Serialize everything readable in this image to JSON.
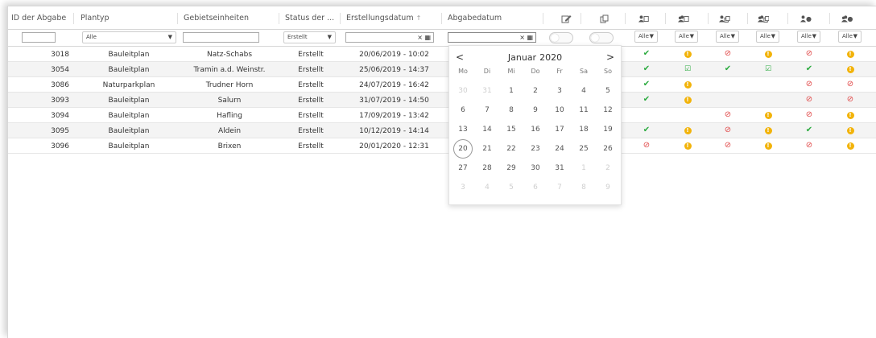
{
  "columns": [
    "ID der Abgabe",
    "Plantyp",
    "Gebietseinheiten",
    "Status der ...",
    "Erstellungsdatum",
    "Abgabedatum"
  ],
  "sort_indicator": "↑",
  "filters": {
    "plantyp": "Alle",
    "status": "Erstellt",
    "date_clear": "×",
    "date_cal": "▦",
    "alle": "Alle"
  },
  "status_icons": [
    "edit-icon",
    "copy-icon",
    "user-edit-icon",
    "group-edit-icon",
    "user-copy-icon",
    "group-copy-icon",
    "user-dot-icon",
    "group-dot-icon"
  ],
  "rows": [
    {
      "id": "3018",
      "plantyp": "Bauleitplan",
      "gebiet": "Natz-Schabs",
      "status": "Erstellt",
      "datum": "20/06/2019 - 10:02",
      "marks": [
        "ok",
        "warn",
        "no",
        "warn",
        "no",
        "warn"
      ]
    },
    {
      "id": "3054",
      "plantyp": "Bauleitplan",
      "gebiet": "Tramin a.d. Weinstr.",
      "status": "Erstellt",
      "datum": "25/06/2019 - 14:37",
      "marks": [
        "ok",
        "edit",
        "ok",
        "edit",
        "ok",
        "warn"
      ]
    },
    {
      "id": "3086",
      "plantyp": "Naturparkplan",
      "gebiet": "Trudner Horn",
      "status": "Erstellt",
      "datum": "24/07/2019 - 16:42",
      "marks": [
        "ok",
        "warn",
        "",
        "",
        "no",
        "no"
      ]
    },
    {
      "id": "3093",
      "plantyp": "Bauleitplan",
      "gebiet": "Salurn",
      "status": "Erstellt",
      "datum": "31/07/2019 - 14:50",
      "marks": [
        "ok",
        "warn",
        "",
        "",
        "no",
        "no"
      ]
    },
    {
      "id": "3094",
      "plantyp": "Bauleitplan",
      "gebiet": "Hafling",
      "status": "Erstellt",
      "datum": "17/09/2019 - 13:42",
      "marks": [
        "",
        "",
        "no",
        "warn",
        "no",
        "warn"
      ]
    },
    {
      "id": "3095",
      "plantyp": "Bauleitplan",
      "gebiet": "Aldein",
      "status": "Erstellt",
      "datum": "10/12/2019 - 14:14",
      "marks": [
        "ok",
        "warn",
        "no",
        "warn",
        "ok",
        "warn"
      ]
    },
    {
      "id": "3096",
      "plantyp": "Bauleitplan",
      "gebiet": "Brixen",
      "status": "Erstellt",
      "datum": "20/01/2020 - 12:31",
      "marks": [
        "no",
        "warn",
        "no",
        "warn",
        "no",
        "warn"
      ]
    }
  ],
  "calendar": {
    "prev": "<",
    "next": ">",
    "month": "Januar",
    "year": "2020",
    "weekdays": [
      "Mo",
      "Di",
      "Mi",
      "Do",
      "Fr",
      "Sa",
      "So"
    ],
    "weeks": [
      [
        "30",
        "31",
        "1",
        "2",
        "3",
        "4",
        "5"
      ],
      [
        "6",
        "7",
        "8",
        "9",
        "10",
        "11",
        "12"
      ],
      [
        "13",
        "14",
        "15",
        "16",
        "17",
        "18",
        "19"
      ],
      [
        "20",
        "21",
        "22",
        "23",
        "24",
        "25",
        "26"
      ],
      [
        "27",
        "28",
        "29",
        "30",
        "31",
        "1",
        "2"
      ],
      [
        "3",
        "4",
        "5",
        "6",
        "7",
        "8",
        "9"
      ]
    ],
    "selected": "20"
  },
  "colors": {
    "ok": "#2bab3f",
    "no": "#e04848",
    "warn": "#f2b30a"
  }
}
